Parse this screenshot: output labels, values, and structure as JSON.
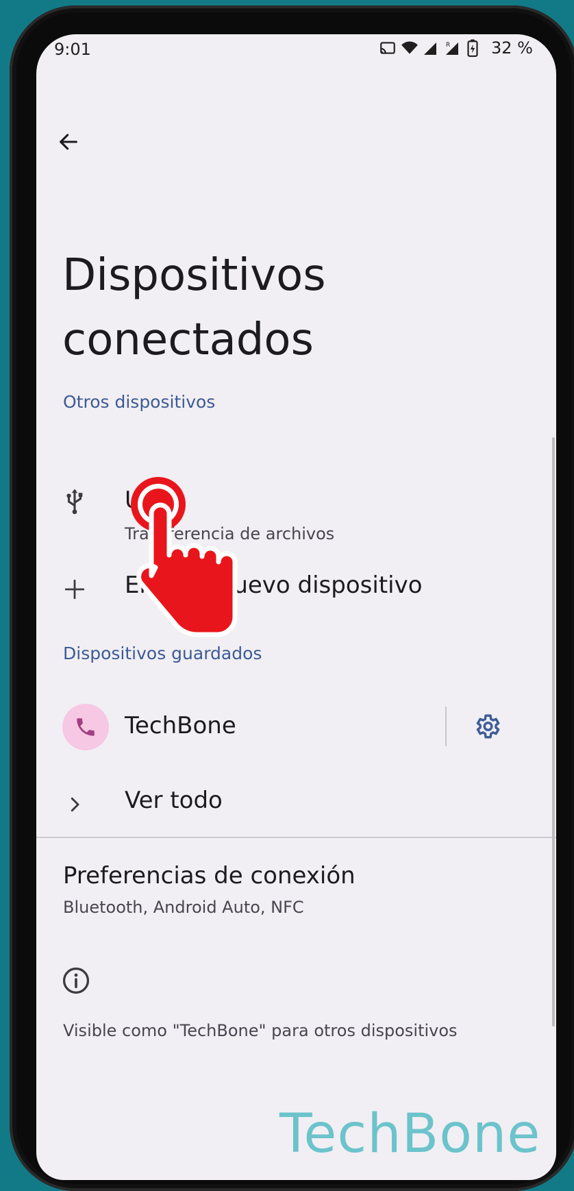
{
  "status_bar": {
    "time": "9:01",
    "icons": [
      "cast-icon",
      "wifi-icon",
      "signal-icon",
      "signal-roaming-icon",
      "battery-charging-icon"
    ],
    "battery": "32 %"
  },
  "header": {
    "back_icon": "arrow-left-icon",
    "title": "Dispositivos conectados"
  },
  "sections": {
    "other_devices": {
      "label": "Otros dispositivos",
      "items": [
        {
          "icon": "usb-icon",
          "title": "USB",
          "subtitle": "Transferencia de archivos"
        },
        {
          "icon": "plus-icon",
          "title": "Enlazar nuevo dispositivo"
        }
      ]
    },
    "saved_devices": {
      "label": "Dispositivos guardados",
      "device": {
        "icon": "phone-icon",
        "name": "TechBone",
        "settings_icon": "gear-icon"
      },
      "see_all": {
        "icon": "chevron-right-icon",
        "label": "Ver todo"
      }
    }
  },
  "preferences": {
    "title": "Preferencias de conexión",
    "subtitle": "Bluetooth, Android Auto, NFC"
  },
  "footer": {
    "info_icon": "info-icon",
    "visible_text": "Visible como \"TechBone\" para otros dispositivos"
  },
  "overlay": {
    "tap_hand_icon": "tap-hand-icon",
    "watermark": "TechBone"
  },
  "colors": {
    "background": "#127a86",
    "screen": "#f1eff3",
    "accent_label": "#3c5a95",
    "gear": "#3e5c99",
    "avatar_bg": "#f6c8e4",
    "avatar_icon": "#a2407f",
    "hand": "#e8161c",
    "watermark": "#6cc3cc"
  }
}
